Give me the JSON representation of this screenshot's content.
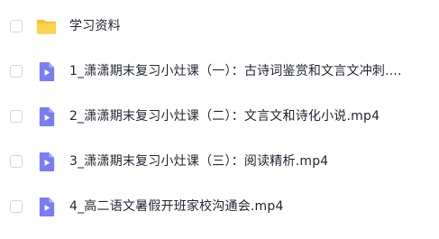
{
  "files": [
    {
      "name": "学习资料",
      "type": "folder",
      "icon": "folder-icon",
      "color": "#f6c13c"
    },
    {
      "name": "1_潇潇期末复习小灶课（一）：古诗词鉴赏和文言文冲刺....",
      "type": "video",
      "icon": "video-file-icon",
      "color": "#7a7cf2"
    },
    {
      "name": "2_潇潇期末复习小灶课（二）：文言文和诗化小说.mp4",
      "type": "video",
      "icon": "video-file-icon",
      "color": "#7a7cf2"
    },
    {
      "name": "3_潇潇期末复习小灶课（三）：阅读精析.mp4",
      "type": "video",
      "icon": "video-file-icon",
      "color": "#7a7cf2"
    },
    {
      "name": "4_高二语文暑假开班家校沟通会.mp4",
      "type": "video",
      "icon": "video-file-icon",
      "color": "#7a7cf2"
    }
  ]
}
